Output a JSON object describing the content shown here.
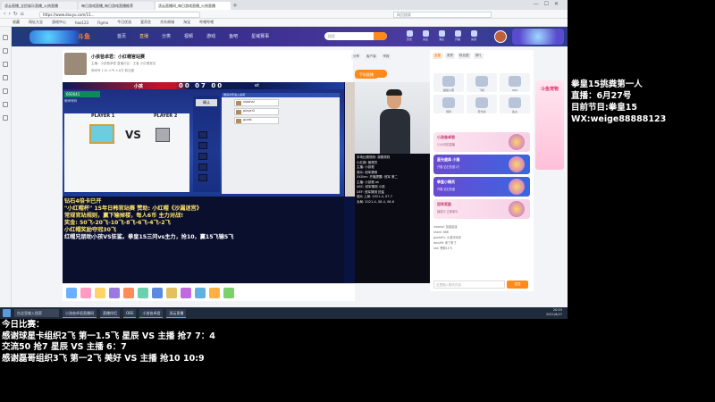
{
  "browser": {
    "tabs": [
      "凌云直播_全民娱乐直播_火热直播",
      "每日游戏直播_每日游戏直播推荐",
      "凌云直播间_每日游戏直播_火热直播"
    ],
    "url": "https://www.douyu.com/11...",
    "search_hint": "网页搜索",
    "bookmarks": [
      "收藏",
      "网址大全",
      "游戏中心",
      "hao123",
      "Figma",
      "今日优选",
      "爱奇艺",
      "京东商城",
      "淘宝",
      "哔哩哔哩"
    ]
  },
  "site_nav": {
    "logo_text": "斗鱼",
    "items": [
      "首页",
      "直播",
      "分类",
      "视频",
      "游戏",
      "鱼吧",
      "星域赛事"
    ],
    "search_placeholder": "搜索",
    "icons": [
      "历史",
      "关注",
      "消息",
      "开播",
      "充值"
    ]
  },
  "room": {
    "title": "小孩爸卓君：小红帽官站赛",
    "sub": "主播：小孩爸卓君  直播分区：王者 小红帽官站",
    "sub2": "房间号 110  人气 5.8万  粉丝团",
    "tools": [
      "分享",
      "客户端",
      "举报"
    ],
    "follow_label": "+ 关注",
    "tag": "手机直播"
  },
  "game": {
    "team_a": "小孩",
    "score": "00 07 00",
    "team_b": "et",
    "id": "692641",
    "sub": "房间号码",
    "player1": "PLAYER 1",
    "player2": "PLAYER 2",
    "vs": "VS",
    "confirm": "确认",
    "panel_head": "邀请对手进入房间",
    "rows": [
      "xiaohai",
      "player2",
      "guest"
    ]
  },
  "stream_text": [
    "钻石4倍卡已开",
    "\"小红帽杯\" 15年日韩官站赛 赞助: 小红帽《沙漏迷宫》",
    "常规官站规则，赢下输掉楼，每人6币 主力对战!",
    "奖金: 50飞-20飞-10飞-8飞-6飞-4飞-2飞",
    "小红帽奖励夺冠30飞",
    "红帽兄朋助小孩VS狂鲨。拳皇15三问vs主力，抢10，赢15飞输5飞"
  ],
  "chat_feed": [
    "本场比赛规则: 观赛规则",
    "小红帽: 管理员",
    "主播: 小孩爸",
    "观众: 冠军猜测",
    "XXXlec: 开播提醒: 冠军 第二",
    "主播: 小孩爸 ok",
    "ABC: 冠军猜测 小孩",
    "DEF: 冠军猜测 狂鲨",
    "观众 上局: 2021-4, 07-7",
    "对局: 2021-4, 08-4, 06-6"
  ],
  "right_panel": {
    "tabs": [
      "全部",
      "贵宾",
      "粉丝团",
      "排行"
    ],
    "gifts": [
      "超级火箭",
      "飞机",
      "666",
      "弱鸡",
      "荧光棒",
      "鱼丸"
    ],
    "cards": [
      {
        "title": "小孩爸卓君",
        "sub": "11小时前直播"
      },
      {
        "title": "星光盛典 小猫",
        "sub": "开播 钻石热度1万"
      },
      {
        "title": "拳皇小精灵",
        "sub": "开播 钻石热度"
      },
      {
        "title": "冠军奖励",
        "sub": "抽奖中 立即参与"
      }
    ],
    "chat": [
      "xiaohai: 加油加油",
      "shark: 666",
      "guest01: 小孩冲冲冲",
      "fans99: 来了来了",
      "red: 赞助10飞"
    ],
    "input_placeholder": "这里输入聊天内容",
    "send_label": "发送"
  },
  "promo": "斗鱼宠物",
  "taskbar": {
    "search": "在这里输入搜索",
    "items": [
      "小孩爸卓君直播间",
      "直播伴侣",
      "OBS",
      "小孩爸卓君",
      "凌云直播"
    ],
    "time": "20:03",
    "date": "2021/6/27"
  },
  "overlay_right": [
    "拳皇15挑粪第一人",
    "直播：6月27号",
    "目前节目:拳皇15",
    "WX:weige88888123"
  ],
  "overlay_bottom": [
    "今日比赛：",
    "感谢球星卡组织2飞 第一1.5飞 星辰 VS 主播 抢7 7：4",
    "交流50 抢7 星辰 VS 主播 6：7",
    "感谢磊哥组织3飞 第一2飞 美好 VS 主播 抢10 10:9"
  ]
}
